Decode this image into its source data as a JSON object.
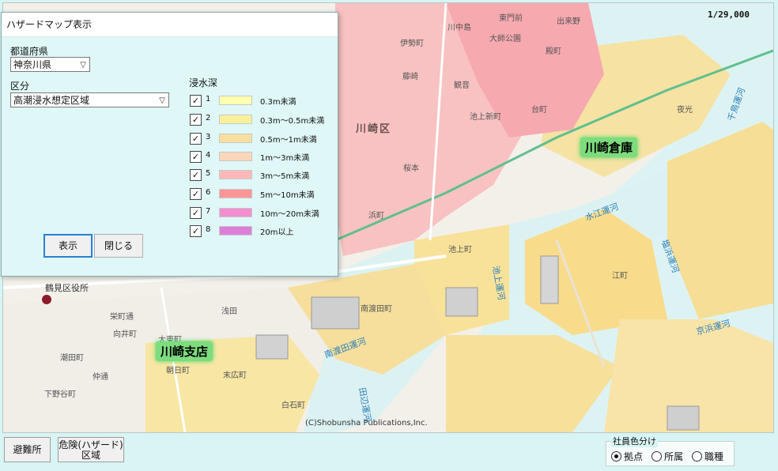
{
  "map": {
    "scale": "1/29,000",
    "copyright": "(C)Shobunsha Publications,Inc.",
    "labels": [
      {
        "text": "川中島"
      },
      {
        "text": "東門前"
      },
      {
        "text": "出来野"
      },
      {
        "text": "大師公園"
      },
      {
        "text": "殿町"
      },
      {
        "text": "伊勢町"
      },
      {
        "text": "藤崎"
      },
      {
        "text": "観音"
      },
      {
        "text": "池上新町"
      },
      {
        "text": "台町"
      },
      {
        "text": "川崎区"
      },
      {
        "text": "桜本"
      },
      {
        "text": "浜町"
      },
      {
        "text": "池上町"
      },
      {
        "text": "鶴見区役所"
      },
      {
        "text": "栄町通"
      },
      {
        "text": "向井町"
      },
      {
        "text": "潮田町"
      },
      {
        "text": "仲通"
      },
      {
        "text": "下野谷町"
      },
      {
        "text": "大東町"
      },
      {
        "text": "朝日町"
      },
      {
        "text": "浅田"
      },
      {
        "text": "末広町"
      },
      {
        "text": "南渡田町"
      },
      {
        "text": "白石町"
      },
      {
        "text": "江町"
      },
      {
        "text": "夜光"
      },
      {
        "text": "千鳥運河"
      },
      {
        "text": "水江運河"
      },
      {
        "text": "塩浜運河"
      },
      {
        "text": "池上運河"
      },
      {
        "text": "南渡田運河"
      },
      {
        "text": "京浜運河"
      },
      {
        "text": "田辺運河"
      }
    ],
    "branches": [
      "川崎倉庫",
      "川崎支店"
    ]
  },
  "dialog": {
    "title": "ハザードマップ表示",
    "prefecture_label": "都道府県",
    "prefecture_value": "神奈川県",
    "category_label": "区分",
    "category_value": "高潮浸水想定区域",
    "depth_label": "浸水深",
    "legend": [
      {
        "num": "1",
        "range": "0.3m未満",
        "color": "#ffffb0",
        "checked": true
      },
      {
        "num": "2",
        "range": "0.3m～0.5m未満",
        "color": "#f8f19c",
        "checked": true
      },
      {
        "num": "3",
        "range": "0.5m～1m未満",
        "color": "#f8df9e",
        "checked": true
      },
      {
        "num": "4",
        "range": "1m～3m未満",
        "color": "#fcd6bb",
        "checked": true
      },
      {
        "num": "5",
        "range": "3m～5m未満",
        "color": "#ffb8b8",
        "checked": true
      },
      {
        "num": "6",
        "range": "5m～10m未満",
        "color": "#ff9696",
        "checked": true
      },
      {
        "num": "7",
        "range": "10m～20m未満",
        "color": "#f28fd0",
        "checked": true
      },
      {
        "num": "8",
        "range": "20m以上",
        "color": "#dc7fd8",
        "checked": true
      }
    ],
    "show_button": "表示",
    "close_button": "閉じる"
  },
  "bottom": {
    "shelter_button": "避難所",
    "hazard_button_line1": "危険(ハザード)",
    "hazard_button_line2": "区域",
    "employee_group_title": "社員色分け",
    "radios": [
      {
        "label": "拠点",
        "selected": true
      },
      {
        "label": "所属",
        "selected": false
      },
      {
        "label": "職種",
        "selected": false
      }
    ]
  }
}
